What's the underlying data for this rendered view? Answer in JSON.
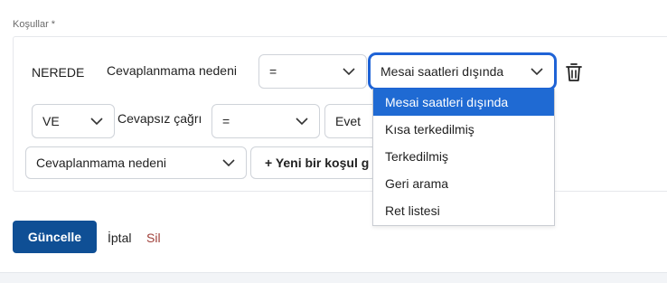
{
  "section": {
    "label": "Koşullar *"
  },
  "row1": {
    "keyword": "NEREDE",
    "field": "Cevaplanmama nedeni",
    "operator": "=",
    "value": "Mesai saatleri dışında"
  },
  "row2": {
    "logic": "VE",
    "field": "Cevapsız çağrı",
    "operator": "=",
    "value": "Evet"
  },
  "row3": {
    "field_select": "Cevaplanmama nedeni",
    "add_button": "+ Yeni bir koşul g"
  },
  "dropdown": {
    "options": [
      "Mesai saatleri dışında",
      "Kısa terkedilmiş",
      "Terkedilmiş",
      "Geri arama",
      "Ret listesi"
    ],
    "selected_index": 0
  },
  "actions": {
    "update": "Güncelle",
    "cancel": "İptal",
    "delete": "Sil"
  },
  "colors": {
    "accent": "#1f63d6",
    "selected_option": "#1f6ad3",
    "primary_button": "#0f4f95",
    "delete_link": "#a0403a"
  }
}
